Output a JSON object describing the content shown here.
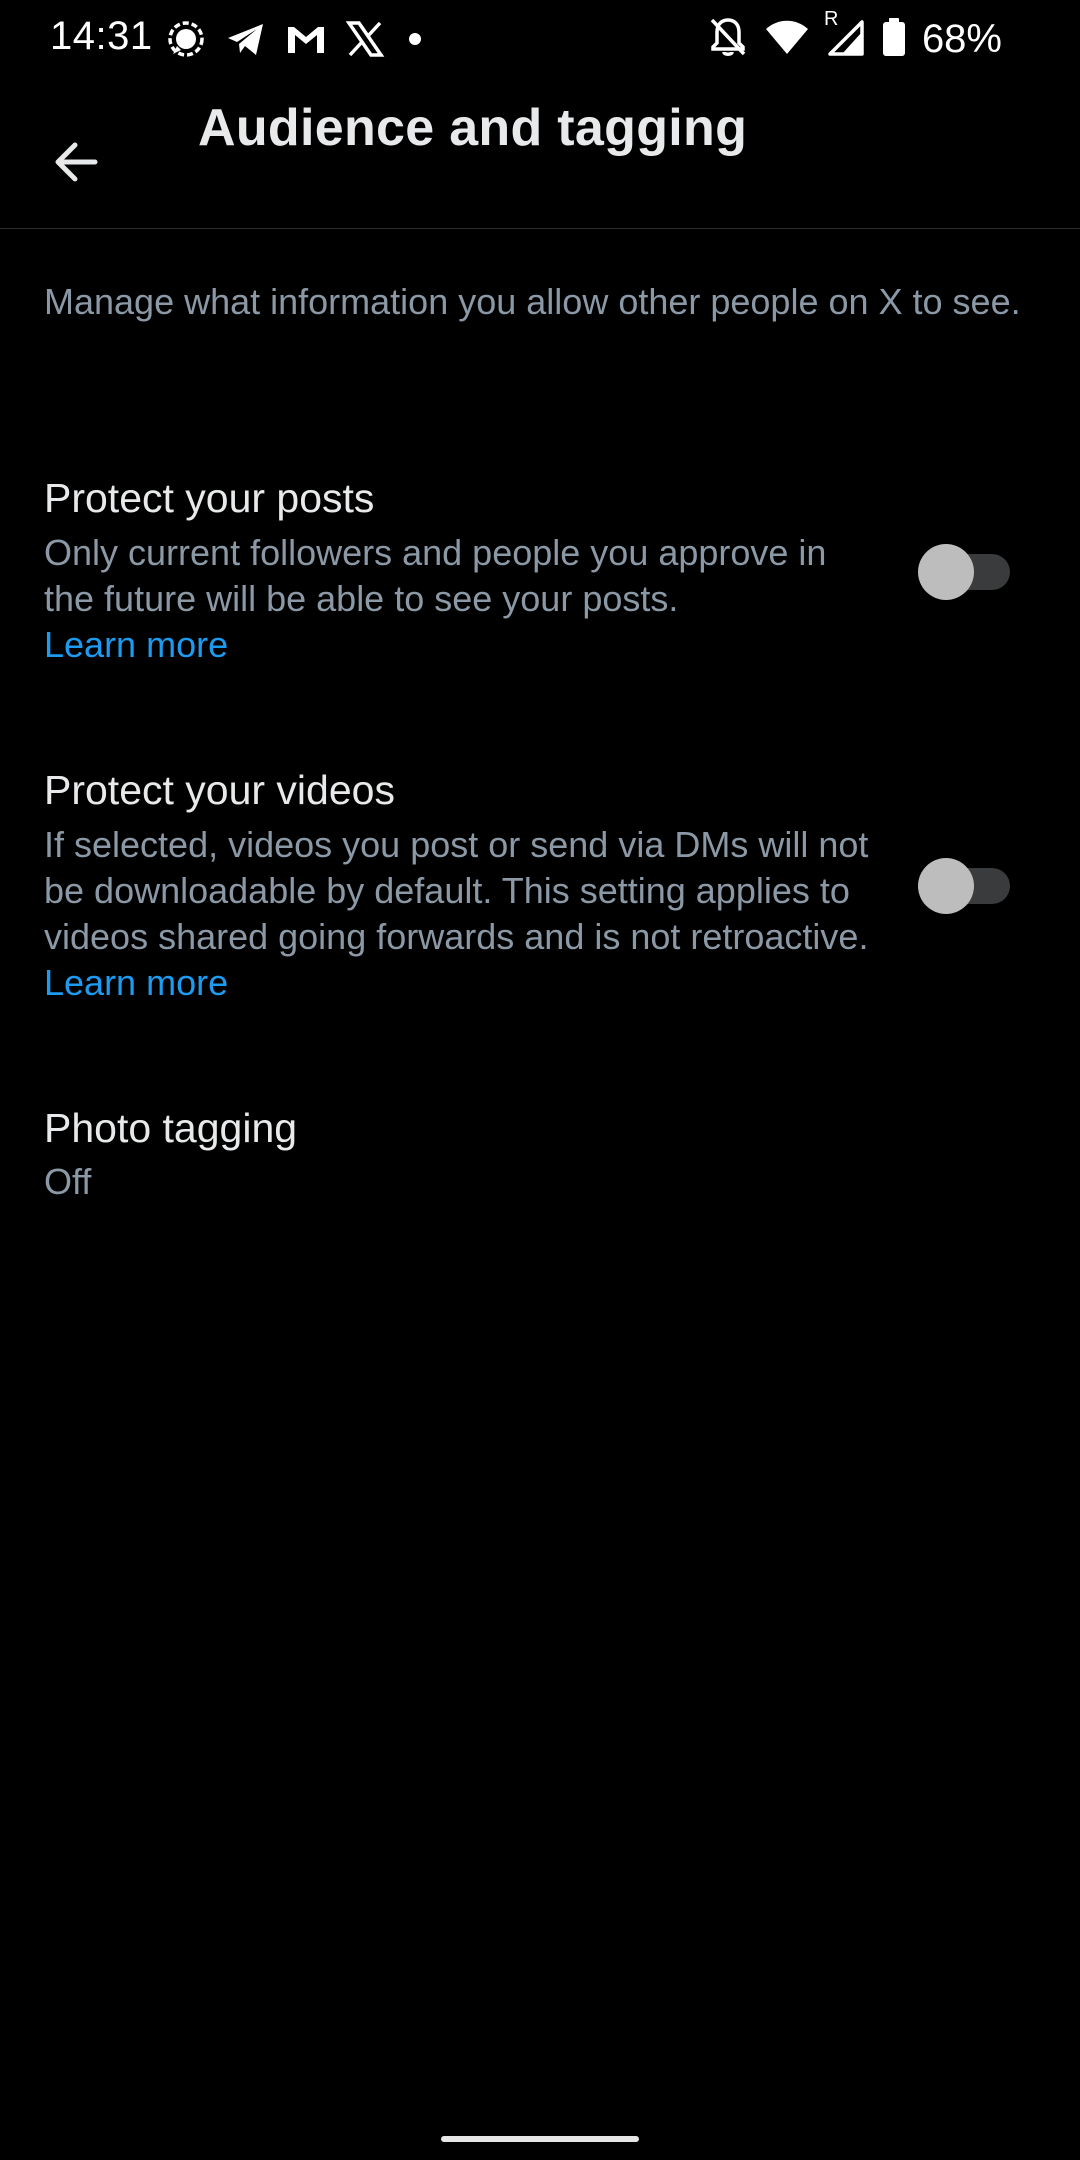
{
  "status_bar": {
    "time": "14:31",
    "battery_percent": "68%",
    "left_icons": [
      "signal-messenger-icon",
      "telegram-icon",
      "gmail-icon",
      "x-logo-icon",
      "dot-icon"
    ],
    "right_icons": [
      "bell-off-icon",
      "wifi-icon",
      "cell-signal-roaming-icon",
      "battery-icon"
    ],
    "cell_roaming_label": "R"
  },
  "app_bar": {
    "title": "Audience and tagging",
    "back_icon": "arrow-left-icon"
  },
  "intro": {
    "text": "Manage what information you allow other people on X to see."
  },
  "settings": [
    {
      "title": "Protect your posts",
      "description": "Only current followers and people you approve in the future will be able to see your posts.",
      "link": "Learn more",
      "toggle_on": false
    },
    {
      "title": "Protect your videos",
      "description": "If selected, videos you post or send via DMs will not be downloadable by default. This setting applies to videos shared going forwards and is not retroactive.",
      "link": "Learn more",
      "toggle_on": false
    },
    {
      "title": "Photo tagging",
      "value": "Off"
    }
  ],
  "colors": {
    "background": "#000000",
    "primary_text": "#e7e9ea",
    "secondary_text": "#8b98a5",
    "link": "#1d9bf0",
    "toggle_track": "#3a3b3c",
    "toggle_thumb": "#bdbdbd"
  }
}
